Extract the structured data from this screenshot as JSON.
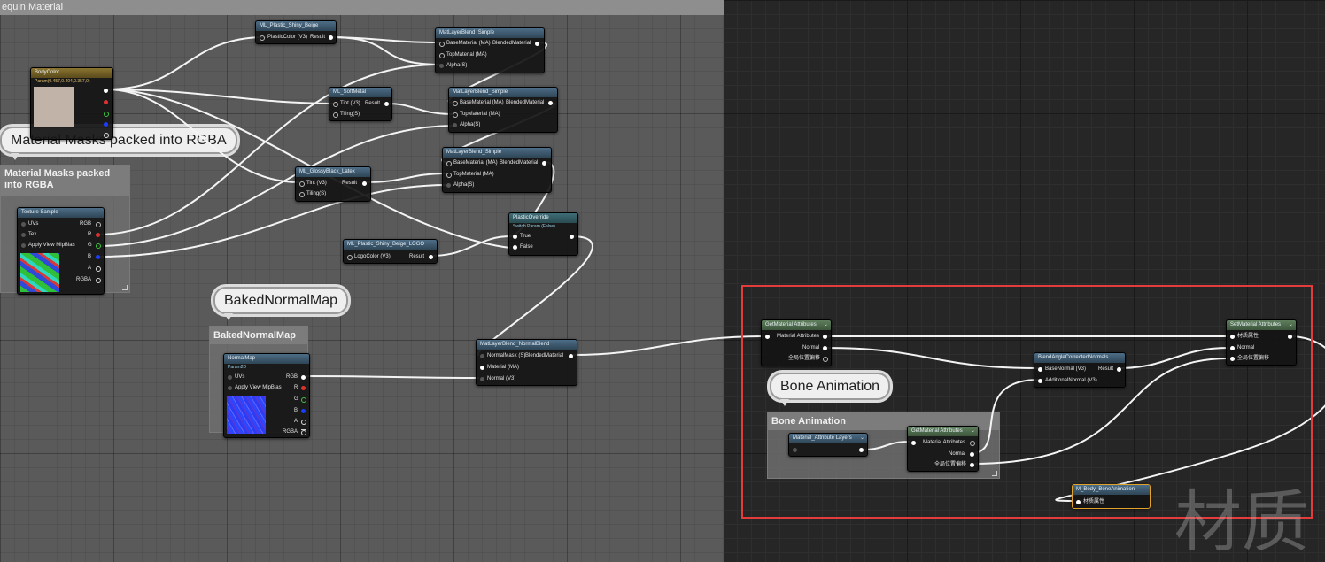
{
  "comment_area": {
    "title": "equin Material"
  },
  "bubbles": {
    "masks": "Material Masks packed into RGBA",
    "baked": "BakedNormalMap",
    "bone": "Bone Animation"
  },
  "sub_comments": {
    "masks": "Material Masks packed into RGBA",
    "baked": "BakedNormalMap",
    "bone": "Bone Animation"
  },
  "nodes": {
    "body_color": {
      "title": "BodyColor",
      "subtitle": "Param(0.457,0.404,0.357,0)"
    },
    "ml_plastic_beige": {
      "title": "ML_Plastic_Shiny_Beige",
      "in": "PlasticColor (V3)",
      "out": "Result"
    },
    "mat_blend_1": {
      "title": "MatLayerBlend_Simple",
      "base": "BaseMaterial (MA)",
      "out": "BlendedMaterial",
      "top": "TopMaterial (MA)",
      "alpha": "Alpha(S)"
    },
    "ml_softmetal": {
      "title": "ML_SoftMetal",
      "tint": "Tint (V3)",
      "out": "Result",
      "tiling": "Tiling(S)"
    },
    "mat_blend_2": {
      "title": "MatLayerBlend_Simple",
      "base": "BaseMaterial (MA)",
      "out": "BlendedMaterial",
      "top": "TopMaterial (MA)",
      "alpha": "Alpha(S)"
    },
    "ml_glossy_black": {
      "title": "ML_GlossyBlack_Latex",
      "tint": "Tint (V3)",
      "out": "Result",
      "tiling": "Tiling(S)"
    },
    "mat_blend_3": {
      "title": "MatLayerBlend_Simple",
      "base": "BaseMaterial (MA)",
      "out": "BlendedMaterial",
      "top": "TopMaterial (MA)",
      "alpha": "Alpha(S)"
    },
    "texture_sample": {
      "title": "Texture Sample",
      "uvs": "UVs",
      "tex": "Tex",
      "mip": "Apply View MipBias",
      "rgb": "RGB",
      "r": "R",
      "g": "G",
      "b": "B",
      "a": "A",
      "rgba": "RGBA"
    },
    "plastic_override": {
      "title": "PlasticOverride",
      "subtitle": "Switch Param (False)",
      "true": "True",
      "false": "False"
    },
    "ml_logo": {
      "title": "ML_Plastic_Shiny_Beige_LOGO",
      "in": "LogoColor (V3)",
      "out": "Result"
    },
    "mat_blend_normal": {
      "title": "MatLayerBlend_NormalBlend",
      "normal_mask": "NormalMask (S)",
      "out": "BlendedMaterial",
      "material": "Material (MA)",
      "normal": "Normal (V3)"
    },
    "normal_map": {
      "title": "NormalMap",
      "subtitle": "Param2D",
      "uvs": "UVs",
      "mip": "Apply View MipBias",
      "rgb": "RGB",
      "r": "R",
      "g": "G",
      "b": "B",
      "a": "A",
      "rgba": "RGBA"
    },
    "get_attr_1": {
      "title": "GetMaterial Attributes",
      "out1": "Material Attributes",
      "out2": "Normal",
      "out3": "全局位置偏移"
    },
    "blend_angle": {
      "title": "BlendAngleCorrectedNormals",
      "base": "BaseNormal (V3)",
      "out": "Result",
      "add": "AdditionalNormal (V3)"
    },
    "set_attr": {
      "title": "SetMaterial Attributes",
      "in1": "材质属性",
      "in2": "Normal",
      "in3": "全局位置偏移"
    },
    "mat_attr_layers": {
      "title": "Material_Attribute Layers"
    },
    "get_attr_2": {
      "title": "GetMaterial Attributes",
      "in": "Material Attributes",
      "out1": "Normal",
      "out2": "全局位置偏移"
    },
    "m_body_bone": {
      "title": "M_Body_BoneAnimation",
      "in": "材质属性"
    }
  },
  "watermark": "材质",
  "colors": {
    "selection": "#e43b3b",
    "wire": "#f4f4f4"
  }
}
